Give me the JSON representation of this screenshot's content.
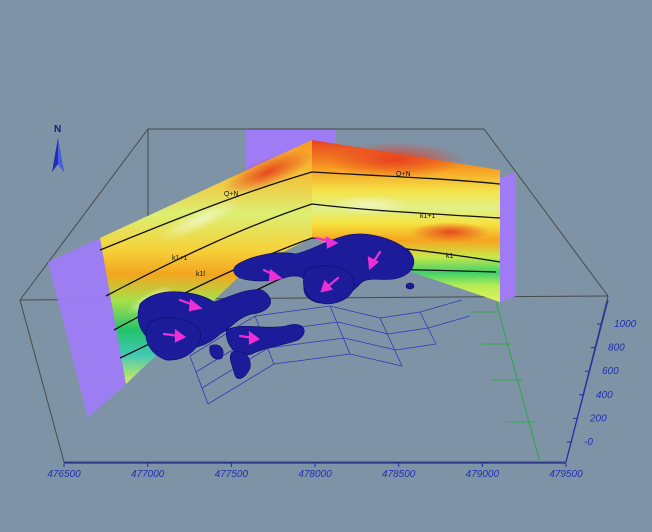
{
  "north_arrow": {
    "label": "N",
    "icon": "north-arrow-icon"
  },
  "layer_labels": {
    "back_wall": [
      "Q+N",
      "k1+1",
      "k1"
    ],
    "left_wall": [
      "Q+N",
      "k1+1",
      "k1l"
    ]
  },
  "x_axis": {
    "ticks": [
      "476500",
      "477000",
      "477500",
      "478000",
      "478500",
      "479000",
      "479500"
    ]
  },
  "z_axis": {
    "ticks": [
      "1000",
      "800",
      "600",
      "400",
      "200",
      "-0"
    ]
  },
  "colors": {
    "background": "#7f93a6",
    "axis_box": "#4a4a4a",
    "axis_tick_text": "#1f2fb5",
    "end_caps": "#9f7cf6",
    "anomaly_body": "#1c1c9a",
    "flow_arrows": "#ee2fd6",
    "green_axis": "#2fa84f"
  }
}
